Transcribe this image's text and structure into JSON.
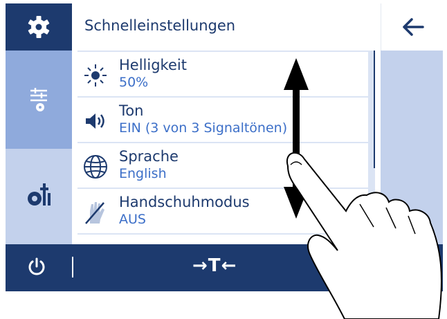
{
  "header": {
    "title": "Schnelleinstellungen"
  },
  "settings": [
    {
      "label": "Helligkeit",
      "value": "50%",
      "icon": "sun-icon"
    },
    {
      "label": "Ton",
      "value": "EIN (3 von 3 Signaltönen)",
      "icon": "speaker-icon"
    },
    {
      "label": "Sprache",
      "value": "English",
      "icon": "globe-icon"
    },
    {
      "label": "Handschuhmodus",
      "value": "AUS",
      "icon": "glove-icon"
    }
  ],
  "bottom_bar": {
    "tare_label": "→T←"
  },
  "sidebar": {
    "icons": [
      "gear-icon",
      "quick-settings-icon",
      "tools-settings-icon"
    ]
  },
  "colors": {
    "primary": "#1d3a6e",
    "accent": "#3c6fc8",
    "sidebar_mid": "#8faadc",
    "sidebar_light": "#c3d1ec",
    "list_bg": "#dbe4f4"
  }
}
